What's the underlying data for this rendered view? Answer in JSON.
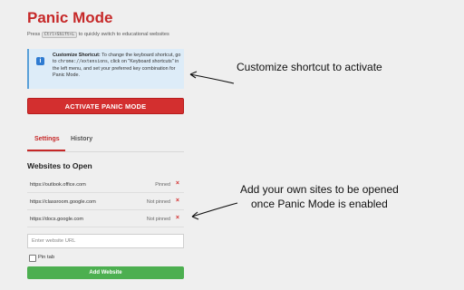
{
  "header": {
    "title": "Panic Mode",
    "subtitle_prefix": "Press",
    "shortcut": "Ctrl+Shift+L",
    "subtitle_suffix": "to quickly switch to educational websites"
  },
  "info": {
    "icon": "info-icon",
    "label": "Customize Shortcut:",
    "text1": "To change the keyboard shortcut, go to",
    "url": "chrome://extensions",
    "text2": ", click on \"Keyboard shortcuts\" in the left menu, and set your preferred key combination for Panic Mode."
  },
  "activate_label": "ACTIVATE PANIC MODE",
  "tabs": [
    "Settings",
    "History"
  ],
  "section_title": "Websites to Open",
  "sites": [
    {
      "url": "https://outlook.office.com",
      "status": "Pinned"
    },
    {
      "url": "https://classroom.google.com",
      "status": "Not pinned"
    },
    {
      "url": "https://docs.google.com",
      "status": "Not pinned"
    }
  ],
  "remove_glyph": "×",
  "input_placeholder": "Enter website URL",
  "pin_label": "Pin tab",
  "add_label": "Add Website",
  "annotations": {
    "shortcut": "Customize shortcut to activate",
    "sites_line1": "Add your own sites to be opened",
    "sites_line2": "once Panic Mode is enabled"
  },
  "colors": {
    "accent": "#c62828",
    "activate_button": "#d32f2f",
    "add_button": "#4caf50",
    "info_background": "#ddecf8",
    "info_icon": "#2f7bd1"
  }
}
